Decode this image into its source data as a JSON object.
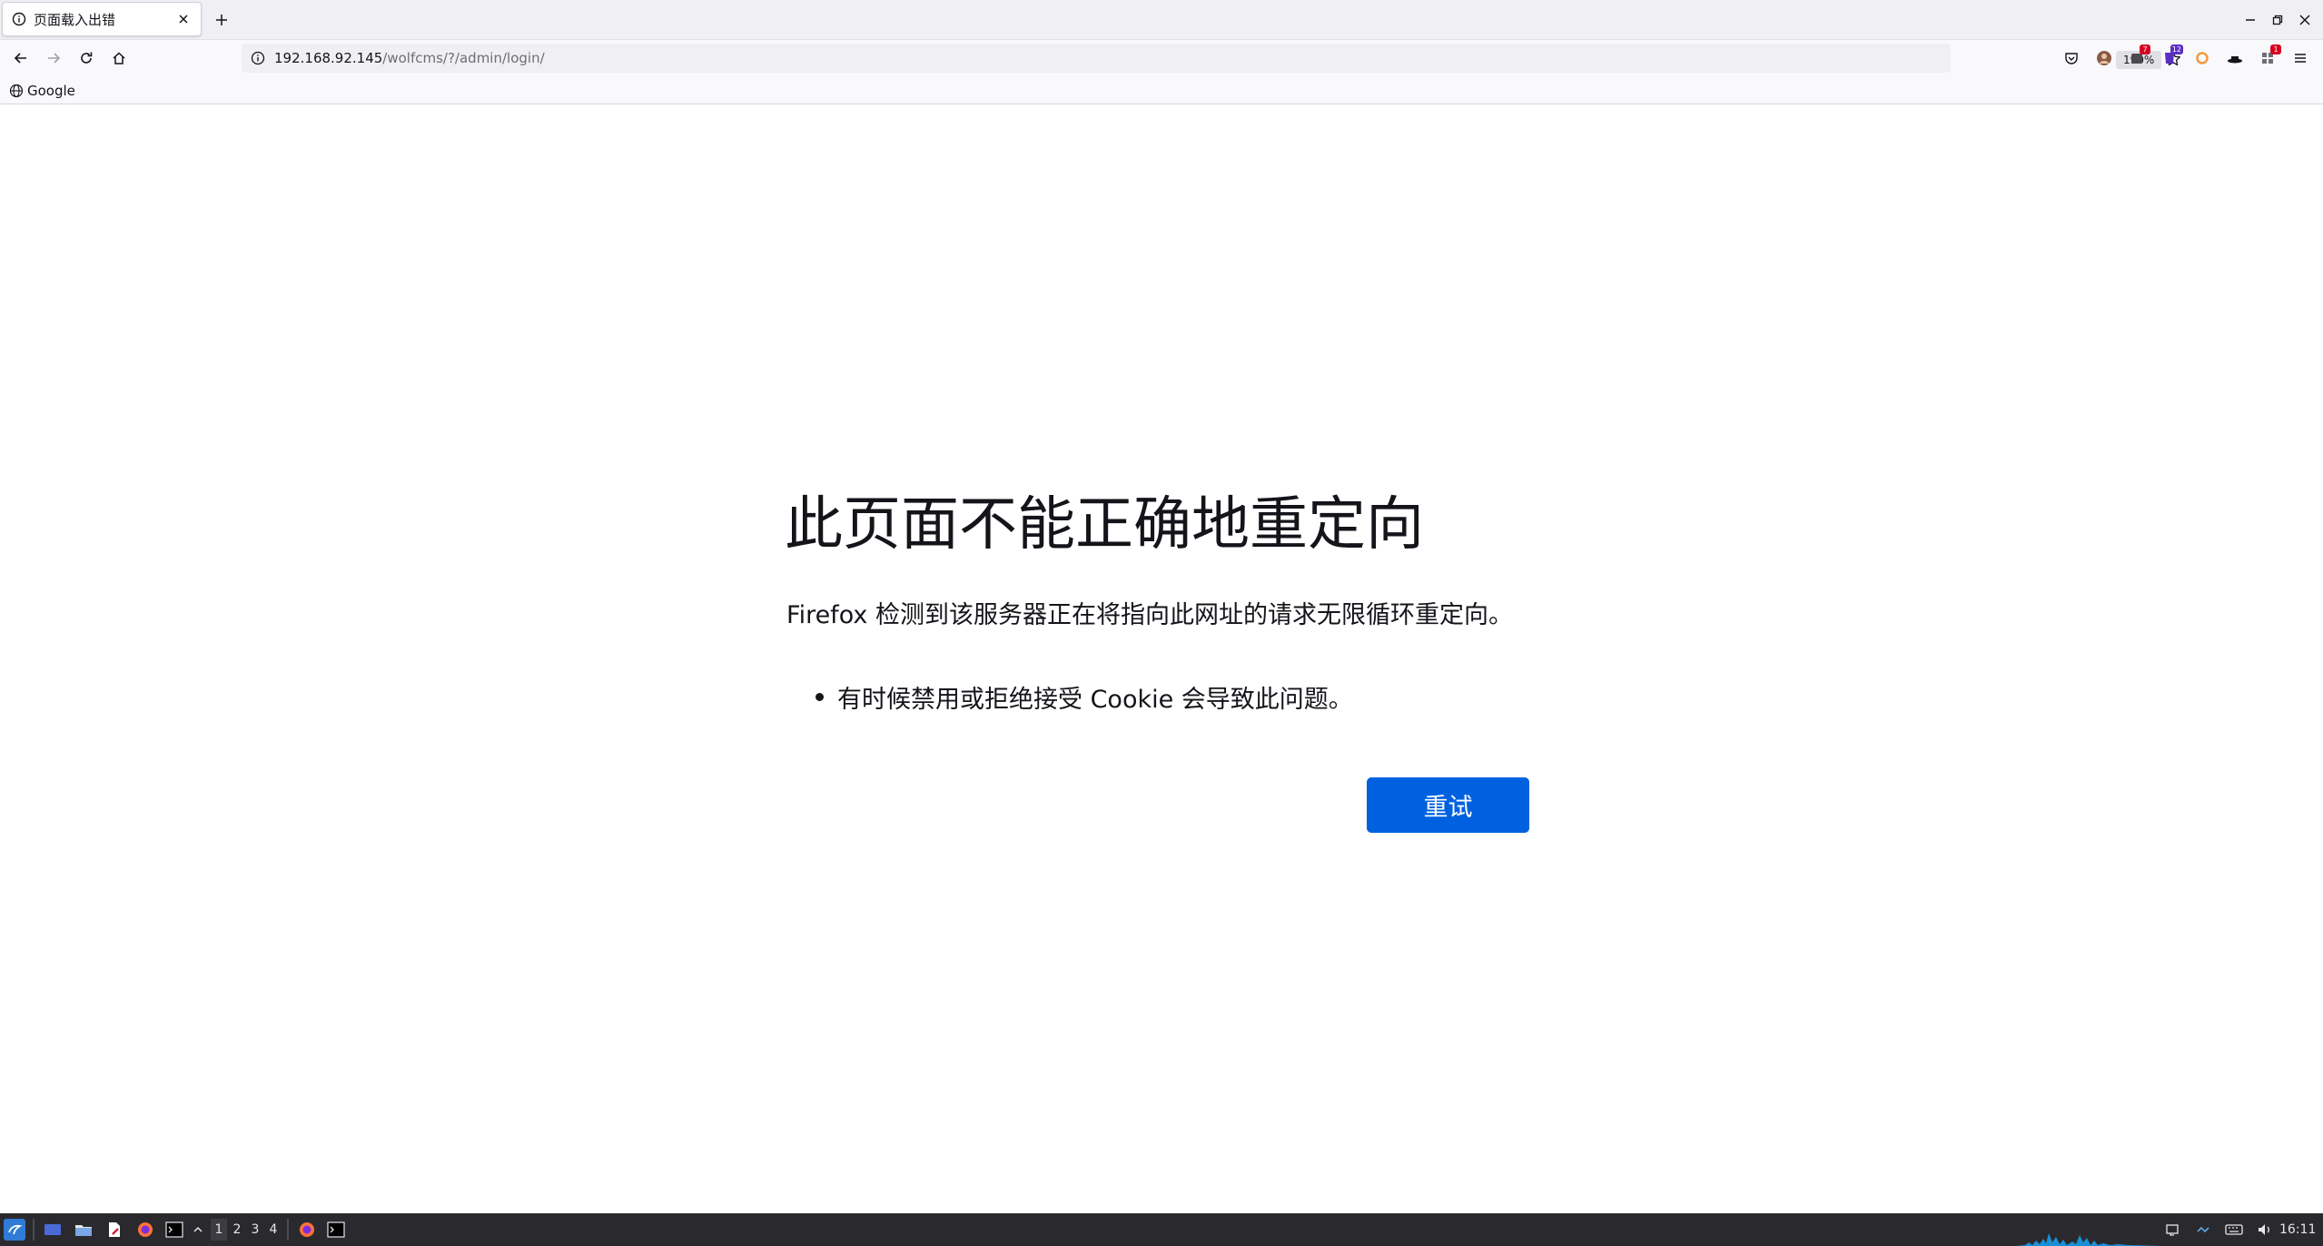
{
  "tab": {
    "title": "页面载入出错"
  },
  "urlbar": {
    "host": "192.168.92.145",
    "path": "/wolfcms/?/admin/login/",
    "zoom": "190%"
  },
  "bookmarks": {
    "items": [
      {
        "label": "Google"
      }
    ]
  },
  "extensions": {
    "badges": [
      "7",
      "12",
      "1"
    ]
  },
  "error": {
    "title": "此页面不能正确地重定向",
    "description": "Firefox 检测到该服务器正在将指向此网址的请求无限循环重定向。",
    "bullets": [
      "有时候禁用或拒绝接受 Cookie 会导致此问题。"
    ],
    "retry_label": "重试"
  },
  "taskbar": {
    "workspaces": [
      "1",
      "2",
      "3",
      "4"
    ],
    "clock": "16:11"
  },
  "colors": {
    "accent": "#0061e0",
    "taskbar": "#2a2a2e"
  }
}
